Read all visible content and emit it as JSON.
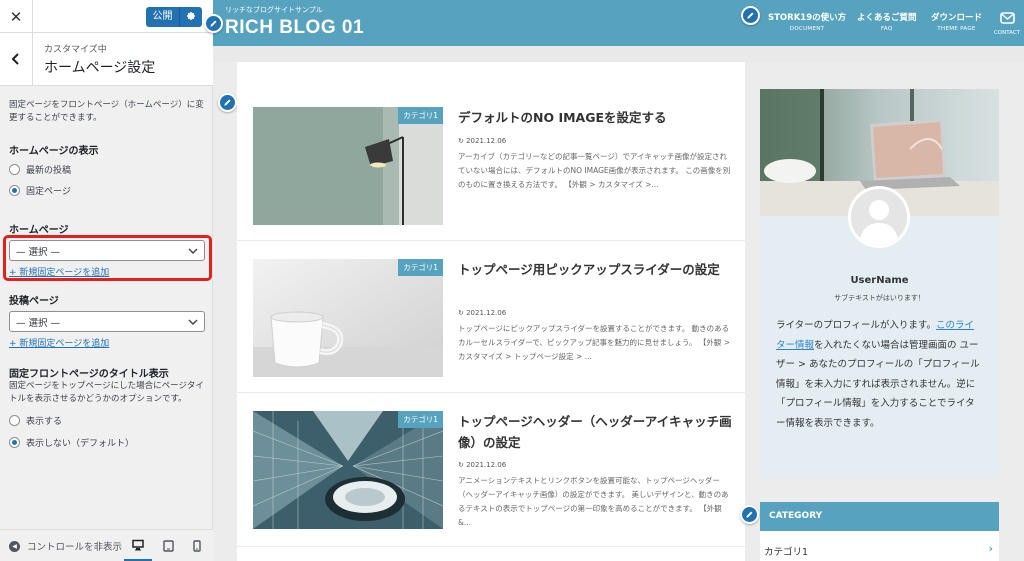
{
  "customizer": {
    "close_glyph": "✕",
    "publish_label": "公開",
    "breadcrumb": "カスタマイズ中",
    "section_title": "ホームページ設定",
    "description": "固定ページをフロントページ（ホームページ）に変更することができます。",
    "homepage_display": {
      "label": "ホームページの表示",
      "options": [
        {
          "label": "最新の投稿",
          "selected": false
        },
        {
          "label": "固定ページ",
          "selected": true
        }
      ]
    },
    "homepage": {
      "label": "ホームページ",
      "select_value": "— 選択 —",
      "add_link": "+ 新規固定ページを追加"
    },
    "posts_page": {
      "label": "投稿ページ",
      "select_value": "— 選択 —",
      "add_link": "+ 新規固定ページを追加"
    },
    "front_title": {
      "label": "固定フロントページのタイトル表示",
      "description": "固定ページをトップページにした場合にページタイトルを表示させるかどうかのオプションです。",
      "options": [
        {
          "label": "表示する",
          "selected": false
        },
        {
          "label": "表示しない（デフォルト）",
          "selected": true
        }
      ]
    },
    "footer": {
      "hide_controls": "コントロールを非表示"
    }
  },
  "site": {
    "tagline": "リッチなブログサイトサンプル",
    "title": "RICH BLOG 01",
    "nav": [
      {
        "main": "STORK19の使い方",
        "sub": "DOCUMENT"
      },
      {
        "main": "よくあるご質問",
        "sub": "FAQ"
      },
      {
        "main": "ダウンロード",
        "sub": "THEME PAGE"
      }
    ],
    "contact_label": "CONTACT",
    "posts": [
      {
        "category": "カテゴリ1",
        "title": "デフォルトのNO IMAGEを設定する",
        "date": "2021.12.06",
        "excerpt": "アーカイブ（カテゴリーなどの記事一覧ページ）でアイキャッチ画像が設定されていない場合には、デフォルトのNO IMAGE画像が表示されます。 この画像を別のものに置き換える方法です。 【外観 > カスタマイズ >..."
      },
      {
        "category": "カテゴリ1",
        "title": "トップページ用ピックアップスライダーの設定",
        "date": "2021.12.06",
        "excerpt": "トップページにピックアップスライダーを設置することができます。 動きのあるカルーセルスライダーで、ピックアップ記事を魅力的に見せましょう。 【外観 > カスタマイズ > トップページ設定 > ..."
      },
      {
        "category": "カテゴリ1",
        "title": "トップページヘッダー（ヘッダーアイキャッチ画像）の設定",
        "date": "2021.12.06",
        "excerpt": "アニメーションテキストとリンクボタンを設置可能な、トップページヘッダー（ヘッダーアイキャッチ画像）の設定ができます。 美しいデザインと、動きのあるテキストの表示でトップページの第一印象を高めることができます。 【外観 &..."
      }
    ],
    "profile": {
      "name": "UserName",
      "subtitle": "サブテキストがはいります！",
      "text_before_link": "ライターのプロフィールが入ります。",
      "link": "このライター情報",
      "text_after_link": "を入れたくない場合は管理画面の ユーザー > あなたのプロフィールの「プロフィール情報」を未入力にすれば表示されません。逆に「プロフィール情報」を入力することでライター情報を表示できます。"
    },
    "category_widget": {
      "heading": "CATEGORY",
      "item": "カテゴリ1"
    }
  },
  "colors": {
    "accent": "#57a3bf",
    "wp_blue": "#2271b1",
    "highlight": "#e2211c"
  }
}
